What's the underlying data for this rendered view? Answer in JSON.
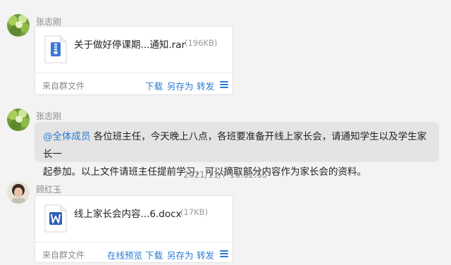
{
  "messages": [
    {
      "sender": "张志刚",
      "file": {
        "name": "关于做好停课期...通知.rar",
        "size": "(196KB)",
        "type": "rar",
        "source": "来自群文件",
        "actions": [
          "下载",
          "另存为",
          "转发"
        ]
      }
    },
    {
      "sender": "张志刚",
      "text": {
        "mention": "@全体成员",
        "line1": " 各位班主任，今天晚上八点，各班要准备开线上家长会，请通知学生以及学生家长一",
        "line2": "起参加。以上文件请班主任提前学习，可以摘取部分内容作为家长会的资料。"
      }
    },
    {
      "timestamp": "2021/11/7 16:52:55"
    },
    {
      "sender": "顾红玉",
      "file": {
        "name": "线上家长会内容...6.docx",
        "size": "(17KB)",
        "type": "docx",
        "source": "来自群文件",
        "actions": [
          "在线预览",
          "下载",
          "另存为",
          "转发"
        ]
      }
    }
  ],
  "icons": {
    "rar": "archive-file-icon",
    "docx": "word-file-icon",
    "menu": "more-menu-icon"
  },
  "colors": {
    "link": "#2a7bd5",
    "bubble": "#e4e4e4",
    "background": "#f3f3f3",
    "word": "#2b5fb8",
    "archive": "#3b78d8"
  }
}
